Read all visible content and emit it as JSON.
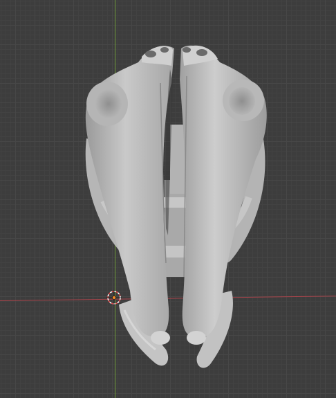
{
  "viewport": {
    "grid": true,
    "colors": {
      "background": "#3d3d3d",
      "grid_line": "#474747",
      "x_axis": "#a8444b",
      "y_axis": "#6f9b3b",
      "mesh": "#bdbdbd",
      "origin": "#f08a24"
    },
    "object": "skull-mesh",
    "icons": [
      "3d-cursor-icon",
      "origin-point-icon"
    ]
  }
}
